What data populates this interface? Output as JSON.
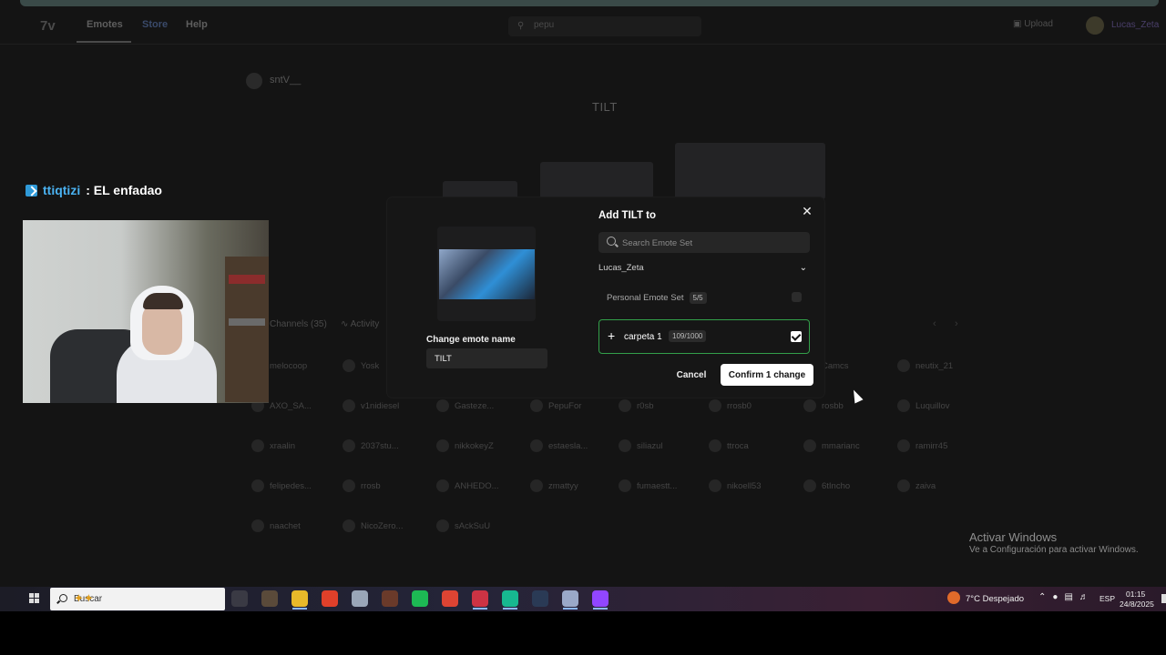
{
  "nav": {
    "logo": "7v",
    "links": [
      "Emotes",
      "Store",
      "Help"
    ],
    "search_value": "pepu",
    "upload_label": "Upload",
    "user": "Lucas_Zeta"
  },
  "emote": {
    "owner": "sntV__",
    "title": "TILT"
  },
  "tabs": {
    "channels": "Channels (35)",
    "activity": "Activity"
  },
  "channel_users": [
    [
      "melocoop",
      "Yosk",
      "",
      "",
      "",
      "",
      "Camcs",
      "neutix_21"
    ],
    [
      "AXO_SA...",
      "v1nidiesel",
      "Gasteze...",
      "PepuFor",
      "r0sb",
      "rrosb0",
      "rosbb",
      "Luquillov"
    ],
    [
      "xraalin",
      "2037stu...",
      "nikkokeyZ",
      "estaesla...",
      "siliazul",
      "ttroca",
      "mmarianc",
      "ramirr45"
    ],
    [
      "felipedes...",
      "rrosb",
      "ANHEDO...",
      "zmattyy",
      "fumaestt...",
      "nikoell53",
      "6tIncho",
      "zaiva"
    ],
    [
      "naachet",
      "NicoZero...",
      "sAckSuU"
    ]
  ],
  "stream": {
    "chat_user": "ttiqtizi",
    "chat_message": ": EL enfadao"
  },
  "modal": {
    "title": "Add TILT to",
    "close_icon": "close-icon",
    "search_placeholder": "Search Emote Set",
    "owner": "Lucas_Zeta",
    "personal_set": {
      "name": "Personal Emote Set",
      "count": "5/5"
    },
    "carpeta": {
      "name": "carpeta 1",
      "count": "109/1000",
      "checked": true,
      "accent": "#33a04a"
    },
    "rename_label": "Change emote name",
    "rename_value": "TILT",
    "cancel_label": "Cancel",
    "confirm_label": "Confirm 1 change"
  },
  "watermark": {
    "title": "Activar Windows",
    "subtitle": "Ve a Configuración para activar Windows."
  },
  "taskbar": {
    "search_placeholder": "Buscar",
    "weather": "7°C  Despejado",
    "language": "ESP",
    "time": "01:15",
    "date": "24/8/2025",
    "apps": [
      {
        "icon": "task-view-icon",
        "color": "#3a3a44"
      },
      {
        "icon": "game-icon",
        "color": "#5a4a3a"
      },
      {
        "icon": "file-explorer-icon",
        "color": "#e8b92a"
      },
      {
        "icon": "microphone-app-icon",
        "color": "#e0402a"
      },
      {
        "icon": "app-icon",
        "color": "#9aa6b8"
      },
      {
        "icon": "game-icon-2",
        "color": "#6a3a2a"
      },
      {
        "icon": "spotify-icon",
        "color": "#1db954"
      },
      {
        "icon": "chrome-icon",
        "color": "#dd4433"
      },
      {
        "icon": "chrome-profile-icon",
        "color": "#cc3344"
      },
      {
        "icon": "app-green-icon",
        "color": "#17b890"
      },
      {
        "icon": "steam-icon",
        "color": "#2a3a55"
      },
      {
        "icon": "shield-app-icon",
        "color": "#9aa8c8"
      },
      {
        "icon": "twitch-app-icon",
        "color": "#9146ff"
      }
    ]
  }
}
